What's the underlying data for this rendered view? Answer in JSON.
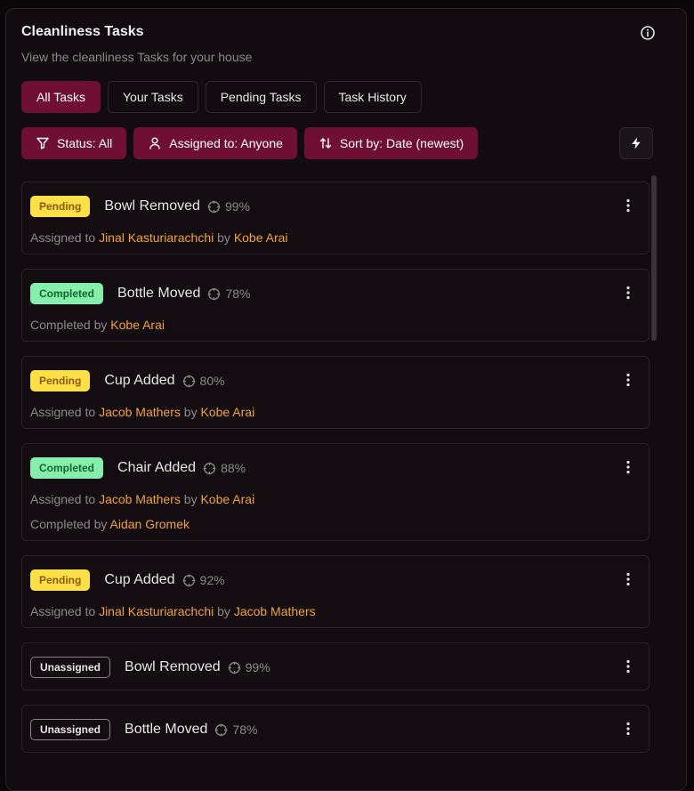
{
  "header": {
    "title": "Cleanliness Tasks",
    "subtitle": "View the cleanliness Tasks for your house"
  },
  "tabs": [
    "All Tasks",
    "Your Tasks",
    "Pending Tasks",
    "Task History"
  ],
  "active_tab": "All Tasks",
  "filters": {
    "status": "Status: All",
    "assigned": "Assigned to: Anyone",
    "sort": "Sort by: Date (newest)"
  },
  "labels": {
    "assigned_to": "Assigned to ",
    "by": " by ",
    "completed_by": "Completed by "
  },
  "tasks": [
    {
      "status": "Pending",
      "name": "Bowl Removed",
      "confidence": "99%",
      "assignee": "Jinal Kasturiarachchi",
      "assigner": "Kobe Arai"
    },
    {
      "status": "Completed",
      "name": "Bottle Moved",
      "confidence": "78%",
      "completer": "Kobe Arai"
    },
    {
      "status": "Pending",
      "name": "Cup Added",
      "confidence": "80%",
      "assignee": "Jacob Mathers",
      "assigner": "Kobe Arai"
    },
    {
      "status": "Completed",
      "name": "Chair Added",
      "confidence": "88%",
      "assignee": "Jacob Mathers",
      "assigner": "Kobe Arai",
      "completer": "Aidan Gromek"
    },
    {
      "status": "Pending",
      "name": "Cup Added",
      "confidence": "92%",
      "assignee": "Jinal Kasturiarachchi",
      "assigner": "Jacob Mathers"
    },
    {
      "status": "Unassigned",
      "name": "Bowl Removed",
      "confidence": "99%"
    },
    {
      "status": "Unassigned",
      "name": "Bottle Moved",
      "confidence": "78%"
    }
  ],
  "colors": {
    "accent": "#6e0f33",
    "pending": "#fde047",
    "completed": "#86efac",
    "person": "#f2a33a"
  }
}
